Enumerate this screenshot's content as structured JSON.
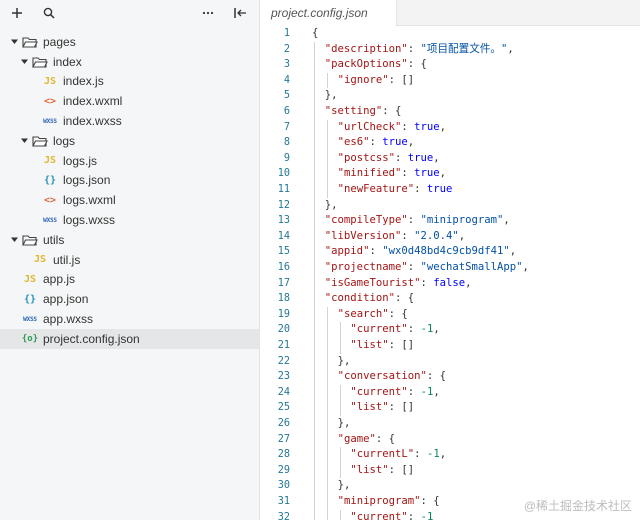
{
  "sidebar": {
    "toolbar": {
      "add_icon": "plus-icon",
      "search_icon": "search-icon",
      "more_icon": "more-icon",
      "collapse_icon": "collapse-panel-icon"
    },
    "tree": [
      {
        "label": "pages",
        "kind": "folder",
        "depth": 0,
        "expanded": true
      },
      {
        "label": "index",
        "kind": "folder",
        "depth": 1,
        "expanded": true
      },
      {
        "label": "index.js",
        "kind": "js",
        "depth": 2
      },
      {
        "label": "index.wxml",
        "kind": "wxml",
        "depth": 2
      },
      {
        "label": "index.wxss",
        "kind": "wxss",
        "depth": 2
      },
      {
        "label": "logs",
        "kind": "folder",
        "depth": 1,
        "expanded": true
      },
      {
        "label": "logs.js",
        "kind": "js",
        "depth": 2
      },
      {
        "label": "logs.json",
        "kind": "json",
        "depth": 2
      },
      {
        "label": "logs.wxml",
        "kind": "wxml",
        "depth": 2
      },
      {
        "label": "logs.wxss",
        "kind": "wxss",
        "depth": 2
      },
      {
        "label": "utils",
        "kind": "folder",
        "depth": 0,
        "expanded": true
      },
      {
        "label": "util.js",
        "kind": "js",
        "depth": 1
      },
      {
        "label": "app.js",
        "kind": "js",
        "depth": 0
      },
      {
        "label": "app.json",
        "kind": "json",
        "depth": 0
      },
      {
        "label": "app.wxss",
        "kind": "wxss",
        "depth": 0
      },
      {
        "label": "project.config.json",
        "kind": "config",
        "depth": 0,
        "selected": true
      }
    ],
    "icon_glyphs": {
      "js": "JS",
      "wxml": "<>",
      "wxss": "WXSS",
      "json": "{}",
      "config": "{o}"
    }
  },
  "tab": {
    "title": "project.config.json"
  },
  "editor": {
    "lines": [
      {
        "n": "1",
        "i": 0,
        "t": [
          [
            "p",
            "{"
          ]
        ]
      },
      {
        "n": "2",
        "i": 1,
        "t": [
          [
            "k",
            "\"description\""
          ],
          [
            "p",
            ": "
          ],
          [
            "s",
            "\"项目配置文件。\""
          ],
          [
            "p",
            ","
          ]
        ]
      },
      {
        "n": "3",
        "i": 1,
        "t": [
          [
            "k",
            "\"packOptions\""
          ],
          [
            "p",
            ": {"
          ]
        ]
      },
      {
        "n": "4",
        "i": 2,
        "t": [
          [
            "k",
            "\"ignore\""
          ],
          [
            "p",
            ": []"
          ]
        ]
      },
      {
        "n": "5",
        "i": 1,
        "t": [
          [
            "p",
            "},"
          ]
        ]
      },
      {
        "n": "6",
        "i": 1,
        "t": [
          [
            "k",
            "\"setting\""
          ],
          [
            "p",
            ": {"
          ]
        ]
      },
      {
        "n": "7",
        "i": 2,
        "t": [
          [
            "k",
            "\"urlCheck\""
          ],
          [
            "p",
            ": "
          ],
          [
            "b",
            "true"
          ],
          [
            "p",
            ","
          ]
        ]
      },
      {
        "n": "8",
        "i": 2,
        "t": [
          [
            "k",
            "\"es6\""
          ],
          [
            "p",
            ": "
          ],
          [
            "b",
            "true"
          ],
          [
            "p",
            ","
          ]
        ]
      },
      {
        "n": "9",
        "i": 2,
        "t": [
          [
            "k",
            "\"postcss\""
          ],
          [
            "p",
            ": "
          ],
          [
            "b",
            "true"
          ],
          [
            "p",
            ","
          ]
        ]
      },
      {
        "n": "10",
        "i": 2,
        "t": [
          [
            "k",
            "\"minified\""
          ],
          [
            "p",
            ": "
          ],
          [
            "b",
            "true"
          ],
          [
            "p",
            ","
          ]
        ]
      },
      {
        "n": "11",
        "i": 2,
        "t": [
          [
            "k",
            "\"newFeature\""
          ],
          [
            "p",
            ": "
          ],
          [
            "b",
            "true"
          ]
        ]
      },
      {
        "n": "12",
        "i": 1,
        "t": [
          [
            "p",
            "},"
          ]
        ]
      },
      {
        "n": "13",
        "i": 1,
        "t": [
          [
            "k",
            "\"compileType\""
          ],
          [
            "p",
            ": "
          ],
          [
            "s",
            "\"miniprogram\""
          ],
          [
            "p",
            ","
          ]
        ]
      },
      {
        "n": "14",
        "i": 1,
        "t": [
          [
            "k",
            "\"libVersion\""
          ],
          [
            "p",
            ": "
          ],
          [
            "s",
            "\"2.0.4\""
          ],
          [
            "p",
            ","
          ]
        ]
      },
      {
        "n": "15",
        "i": 1,
        "t": [
          [
            "k",
            "\"appid\""
          ],
          [
            "p",
            ": "
          ],
          [
            "s",
            "\"wx0d48bd4c9cb9df41\""
          ],
          [
            "p",
            ","
          ]
        ]
      },
      {
        "n": "16",
        "i": 1,
        "t": [
          [
            "k",
            "\"projectname\""
          ],
          [
            "p",
            ": "
          ],
          [
            "s",
            "\"wechatSmallApp\""
          ],
          [
            "p",
            ","
          ]
        ]
      },
      {
        "n": "17",
        "i": 1,
        "t": [
          [
            "k",
            "\"isGameTourist\""
          ],
          [
            "p",
            ": "
          ],
          [
            "b",
            "false"
          ],
          [
            "p",
            ","
          ]
        ]
      },
      {
        "n": "18",
        "i": 1,
        "t": [
          [
            "k",
            "\"condition\""
          ],
          [
            "p",
            ": {"
          ]
        ]
      },
      {
        "n": "19",
        "i": 2,
        "t": [
          [
            "k",
            "\"search\""
          ],
          [
            "p",
            ": {"
          ]
        ]
      },
      {
        "n": "20",
        "i": 3,
        "t": [
          [
            "k",
            "\"current\""
          ],
          [
            "p",
            ": "
          ],
          [
            "n",
            "-1"
          ],
          [
            "p",
            ","
          ]
        ]
      },
      {
        "n": "21",
        "i": 3,
        "t": [
          [
            "k",
            "\"list\""
          ],
          [
            "p",
            ": []"
          ]
        ]
      },
      {
        "n": "22",
        "i": 2,
        "t": [
          [
            "p",
            "},"
          ]
        ]
      },
      {
        "n": "23",
        "i": 2,
        "t": [
          [
            "k",
            "\"conversation\""
          ],
          [
            "p",
            ": {"
          ]
        ]
      },
      {
        "n": "24",
        "i": 3,
        "t": [
          [
            "k",
            "\"current\""
          ],
          [
            "p",
            ": "
          ],
          [
            "n",
            "-1"
          ],
          [
            "p",
            ","
          ]
        ]
      },
      {
        "n": "25",
        "i": 3,
        "t": [
          [
            "k",
            "\"list\""
          ],
          [
            "p",
            ": []"
          ]
        ]
      },
      {
        "n": "26",
        "i": 2,
        "t": [
          [
            "p",
            "},"
          ]
        ]
      },
      {
        "n": "27",
        "i": 2,
        "t": [
          [
            "k",
            "\"game\""
          ],
          [
            "p",
            ": {"
          ]
        ]
      },
      {
        "n": "28",
        "i": 3,
        "t": [
          [
            "k",
            "\"currentL\""
          ],
          [
            "p",
            ": "
          ],
          [
            "n",
            "-1"
          ],
          [
            "p",
            ","
          ]
        ]
      },
      {
        "n": "29",
        "i": 3,
        "t": [
          [
            "k",
            "\"list\""
          ],
          [
            "p",
            ": []"
          ]
        ]
      },
      {
        "n": "30",
        "i": 2,
        "t": [
          [
            "p",
            "},"
          ]
        ]
      },
      {
        "n": "31",
        "i": 2,
        "t": [
          [
            "k",
            "\"miniprogram\""
          ],
          [
            "p",
            ": {"
          ]
        ]
      },
      {
        "n": "32",
        "i": 3,
        "t": [
          [
            "k",
            "\"current\""
          ],
          [
            "p",
            ": "
          ],
          [
            "n",
            "-1"
          ]
        ]
      }
    ]
  },
  "watermark": "@稀土掘金技术社区"
}
